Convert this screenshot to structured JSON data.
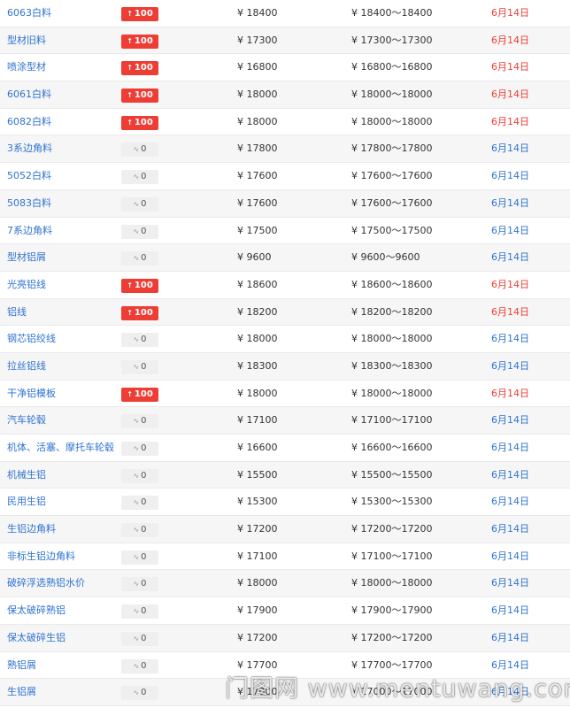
{
  "currency_symbol": "¥",
  "rows": [
    {
      "name": "6063白料",
      "change": "100",
      "direction": "up",
      "price": "18400",
      "range": "18400～18400",
      "date": "6月14日"
    },
    {
      "name": "型材旧料",
      "change": "100",
      "direction": "up",
      "price": "17300",
      "range": "17300～17300",
      "date": "6月14日"
    },
    {
      "name": "喷涂型材",
      "change": "100",
      "direction": "up",
      "price": "16800",
      "range": "16800～16800",
      "date": "6月14日"
    },
    {
      "name": "6061白料",
      "change": "100",
      "direction": "up",
      "price": "18000",
      "range": "18000～18000",
      "date": "6月14日"
    },
    {
      "name": "6082白料",
      "change": "100",
      "direction": "up",
      "price": "18000",
      "range": "18000～18000",
      "date": "6月14日"
    },
    {
      "name": "3系边角料",
      "change": "0",
      "direction": "flat",
      "price": "17800",
      "range": "17800～17800",
      "date": "6月14日"
    },
    {
      "name": "5052白料",
      "change": "0",
      "direction": "flat",
      "price": "17600",
      "range": "17600～17600",
      "date": "6月14日"
    },
    {
      "name": "5083白料",
      "change": "0",
      "direction": "flat",
      "price": "17600",
      "range": "17600～17600",
      "date": "6月14日"
    },
    {
      "name": "7系边角料",
      "change": "0",
      "direction": "flat",
      "price": "17500",
      "range": "17500～17500",
      "date": "6月14日"
    },
    {
      "name": "型材铝屑",
      "change": "0",
      "direction": "flat",
      "price": "9600",
      "range": "9600～9600",
      "date": "6月14日"
    },
    {
      "name": "光亮铝线",
      "change": "100",
      "direction": "up",
      "price": "18600",
      "range": "18600～18600",
      "date": "6月14日"
    },
    {
      "name": "铝线",
      "change": "100",
      "direction": "up",
      "price": "18200",
      "range": "18200～18200",
      "date": "6月14日"
    },
    {
      "name": "钢芯铝绞线",
      "change": "0",
      "direction": "flat",
      "price": "18000",
      "range": "18000～18000",
      "date": "6月14日"
    },
    {
      "name": "拉丝铝线",
      "change": "0",
      "direction": "flat",
      "price": "18300",
      "range": "18300～18300",
      "date": "6月14日"
    },
    {
      "name": "干净铝模板",
      "change": "100",
      "direction": "up",
      "price": "18000",
      "range": "18000～18000",
      "date": "6月14日"
    },
    {
      "name": "汽车轮毂",
      "change": "0",
      "direction": "flat",
      "price": "17100",
      "range": "17100～17100",
      "date": "6月14日"
    },
    {
      "name": "机体、活塞、摩托车轮毂",
      "change": "0",
      "direction": "flat",
      "price": "16600",
      "range": "16600～16600",
      "date": "6月14日"
    },
    {
      "name": "机械生铝",
      "change": "0",
      "direction": "flat",
      "price": "15500",
      "range": "15500～15500",
      "date": "6月14日"
    },
    {
      "name": "民用生铝",
      "change": "0",
      "direction": "flat",
      "price": "15300",
      "range": "15300～15300",
      "date": "6月14日"
    },
    {
      "name": "生铝边角料",
      "change": "0",
      "direction": "flat",
      "price": "17200",
      "range": "17200～17200",
      "date": "6月14日"
    },
    {
      "name": "非标生铝边角料",
      "change": "0",
      "direction": "flat",
      "price": "17100",
      "range": "17100～17100",
      "date": "6月14日"
    },
    {
      "name": "破碎浮选熟铝水价",
      "change": "0",
      "direction": "flat",
      "price": "18000",
      "range": "18000～18000",
      "date": "6月14日"
    },
    {
      "name": "保太破碎熟铝",
      "change": "0",
      "direction": "flat",
      "price": "17900",
      "range": "17900～17900",
      "date": "6月14日"
    },
    {
      "name": "保太破碎生铝",
      "change": "0",
      "direction": "flat",
      "price": "17200",
      "range": "17200～17200",
      "date": "6月14日"
    },
    {
      "name": "熟铝屑",
      "change": "0",
      "direction": "flat",
      "price": "17700",
      "range": "17700～17700",
      "date": "6月14日"
    },
    {
      "name": "生铝屑",
      "change": "0",
      "direction": "flat",
      "price": "17000",
      "range": "17000～17000",
      "date": "6月14日"
    }
  ],
  "colors": {
    "up": "#ee3d35",
    "flat_badge": "#efefef",
    "link": "#2f73d0",
    "stripe": "#f6f6f6"
  },
  "icons": {
    "up": "arrow-up-icon",
    "flat": "wave-icon"
  },
  "watermark": "门图网 www.mentuwang.com"
}
